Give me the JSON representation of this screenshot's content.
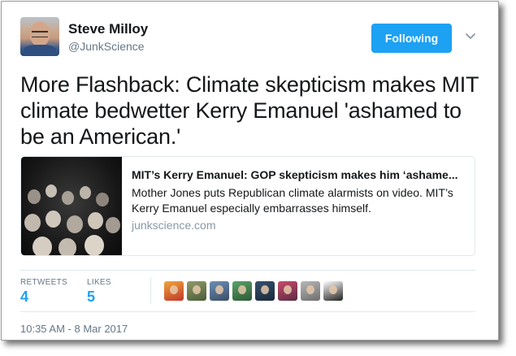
{
  "author": {
    "name": "Steve Milloy",
    "handle": "@JunkScience"
  },
  "follow_button": {
    "label": "Following",
    "color": "#1da1f2"
  },
  "tweet": {
    "text": "More Flashback: Climate skepticism makes MIT climate bedwetter Kerry Emanuel 'ashamed to be an American.'"
  },
  "link_card": {
    "title": "MIT’s Kerry Emanuel: GOP skepticism makes him ‘ashame...",
    "description": "Mother Jones puts Republican climate alarmists on video. MIT’s Kerry Emanuel especially embarrasses himself.",
    "domain": "junkscience.com"
  },
  "stats": {
    "retweets_label": "RETWEETS",
    "retweets_count": "4",
    "likes_label": "LIKES",
    "likes_count": "5"
  },
  "likers": [
    {
      "icon": "liker-avatar",
      "colors": [
        "#f0a53a",
        "#c0392b"
      ]
    },
    {
      "icon": "liker-avatar",
      "colors": [
        "#8f9b6a",
        "#4c5c38"
      ]
    },
    {
      "icon": "liker-avatar",
      "colors": [
        "#6d8fb3",
        "#3a4e68"
      ]
    },
    {
      "icon": "liker-avatar",
      "colors": [
        "#5aa36a",
        "#2d5a37"
      ]
    },
    {
      "icon": "liker-avatar",
      "colors": [
        "#35506e",
        "#1c2a3a"
      ]
    },
    {
      "icon": "liker-avatar",
      "colors": [
        "#c94d6a",
        "#5a2a45"
      ]
    },
    {
      "icon": "liker-avatar",
      "colors": [
        "#b7b7b7",
        "#6e6e6e"
      ]
    },
    {
      "icon": "liker-avatar",
      "colors": [
        "#ffffff",
        "#222222"
      ]
    }
  ],
  "timestamp": "10:35 AM - 8 Mar 2017"
}
